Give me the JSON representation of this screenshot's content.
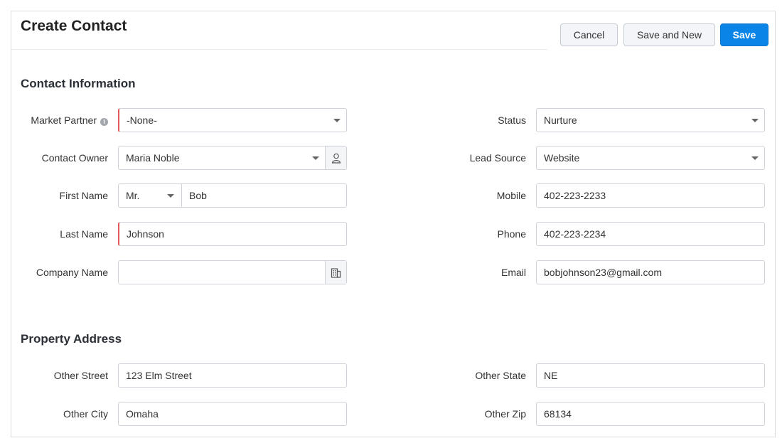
{
  "header": {
    "title": "Create Contact",
    "cancel_label": "Cancel",
    "save_new_label": "Save and New",
    "save_label": "Save"
  },
  "contact_section": {
    "title": "Contact Information",
    "market_partner": {
      "label": "Market Partner",
      "value": "-None-"
    },
    "contact_owner": {
      "label": "Contact Owner",
      "value": "Maria Noble"
    },
    "first_name": {
      "label": "First Name",
      "salutation": "Mr.",
      "value": "Bob"
    },
    "last_name": {
      "label": "Last Name",
      "value": "Johnson"
    },
    "company_name": {
      "label": "Company Name",
      "value": ""
    },
    "status": {
      "label": "Status",
      "value": "Nurture"
    },
    "lead_source": {
      "label": "Lead Source",
      "value": "Website"
    },
    "mobile": {
      "label": "Mobile",
      "value": "402-223-2233"
    },
    "phone": {
      "label": "Phone",
      "value": "402-223-2234"
    },
    "email": {
      "label": "Email",
      "value": "bobjohnson23@gmail.com"
    }
  },
  "address_section": {
    "title": "Property Address",
    "other_street": {
      "label": "Other Street",
      "value": "123 Elm Street"
    },
    "other_city": {
      "label": "Other City",
      "value": "Omaha"
    },
    "other_state": {
      "label": "Other State",
      "value": "NE"
    },
    "other_zip": {
      "label": "Other Zip",
      "value": "68134"
    }
  },
  "icons": {
    "info": "info-icon",
    "owner_lookup": "user-lookup-icon",
    "company_lookup": "building-icon",
    "dropdown": "chevron-down-icon"
  },
  "colors": {
    "primary": "#0b84e8",
    "mandatory": "#e05a5a"
  }
}
